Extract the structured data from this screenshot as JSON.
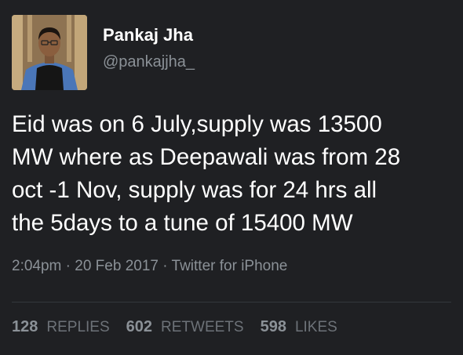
{
  "colors": {
    "background": "#1f2023",
    "text_primary": "#ffffff",
    "text_secondary": "#8b9197",
    "divider": "#34383c"
  },
  "author": {
    "name": "Pankaj Jha",
    "handle": "@pankajjha_",
    "avatar_icon": "profile-photo"
  },
  "tweet": {
    "text": "Eid was on 6 July,supply was 13500\nMW where as Deepawali was from 28\noct -1 Nov, supply was for 24 hrs all\nthe 5days to a tune of 15400 MW"
  },
  "meta": {
    "time": "2:04pm",
    "sep1": " · ",
    "date": "20 Feb 2017",
    "sep2": " · ",
    "source": "Twitter for iPhone"
  },
  "stats": {
    "replies": {
      "count": "128",
      "label": "REPLIES"
    },
    "retweets": {
      "count": "602",
      "label": "RETWEETS"
    },
    "likes": {
      "count": "598",
      "label": "LIKES"
    }
  }
}
